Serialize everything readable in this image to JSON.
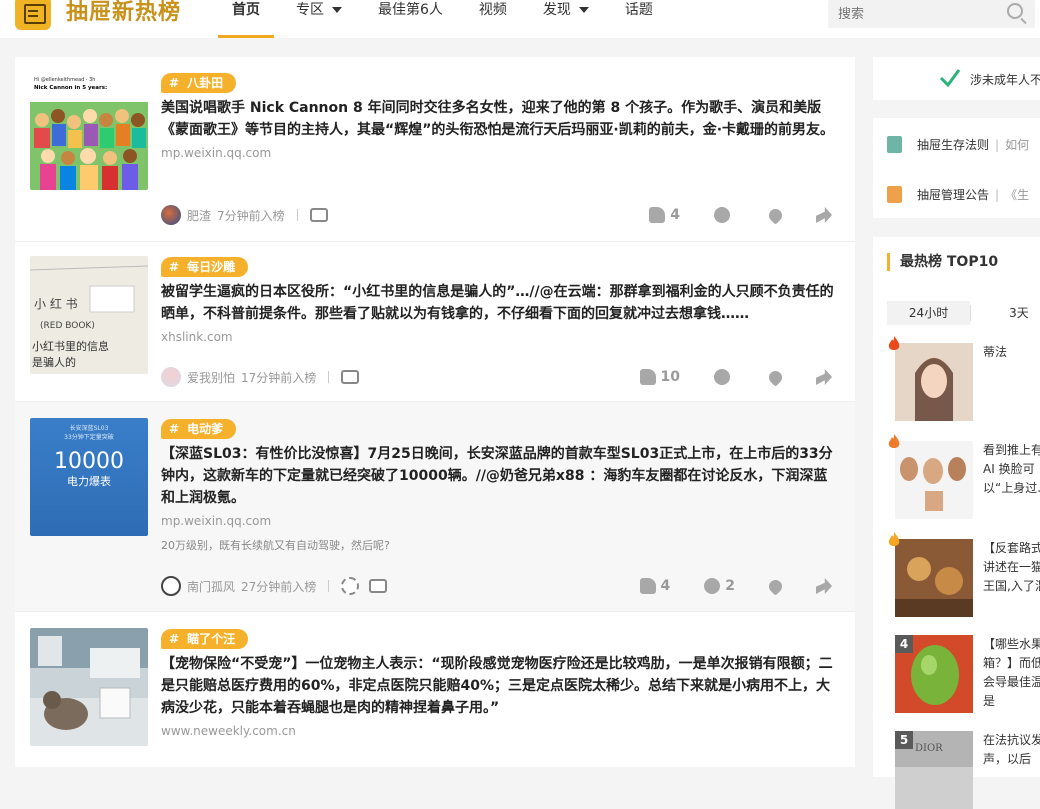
{
  "header": {
    "logo_text": "抽屉新热榜",
    "nav": [
      "首页",
      "专区",
      "最佳第6人",
      "视频",
      "发现",
      "话题"
    ],
    "search_placeholder": "搜索"
  },
  "posts": [
    {
      "tag": "八卦田",
      "thumb_text_1": "Hi @ellenkeithmead · 3h",
      "thumb_text_2": "Nick Cannon in 5 years:",
      "title": "美国说唱歌手 Nick Cannon 8 年间同时交往多名女性，迎来了他的第 8 个孩子。作为歌手、演员和美版《蒙面歌王》等节目的主持人，其最“辉煌”的头衔恐怕是流行天后玛丽亚·凯莉的前夫，金·卡戴珊的前男友。",
      "domain": "mp.weixin.qq.com",
      "author": "肥渣",
      "time": "7分钟前入榜",
      "likes": "4",
      "comments": ""
    },
    {
      "tag": "每日沙雕",
      "thumb_text_1": "(RED BOOK)",
      "thumb_text_2": "小红书里的信息是骗人的",
      "title": "被留学生逼疯的日本区役所：“小红书里的信息是骗人的”…//@在云端：那群拿到福利金的人只顾不负责任的晒单，不科普前提条件。那些看了贴就以为有钱拿的，不仔细看下面的回复就冲过去想拿钱……",
      "domain": "xhslink.com",
      "author": "爱我别怕",
      "time": "17分钟前入榜",
      "likes": "10",
      "comments": ""
    },
    {
      "tag": "电动爹",
      "thumb_text_1": "长安深蓝SL03",
      "thumb_text_2": "33分钟下定量突破",
      "thumb_text_3": "10000",
      "thumb_text_4": "电力爆表",
      "title": "【深蓝SL03：有性价比没惊喜】7月25日晚间，长安深蓝品牌的首款车型SL03正式上市，在上市后的33分钟内，这款新车的下定量就已经突破了10000辆。//@奶爸兄弟x88 ：海豹车友圈都在讨论反水，下润深蓝和上润极氪。",
      "domain": "mp.weixin.qq.com",
      "excerpt": "20万级别，既有长续航又有自动驾驶，然后呢?",
      "author": "南门孤风",
      "time": "27分钟前入榜",
      "likes": "4",
      "comments": "2"
    },
    {
      "tag": "瞄了个汪",
      "title": "【宠物保险“不受宠”】一位宠物主人表示：“现阶段感觉宠物医疗险还是比较鸡肋，一是单次报销有限额；二是只能赔总医疗费用的60%，非定点医院只能赔40%；三是定点医院太稀少。总结下来就是小病用不上，大病没少花，只能本着吞蝇腿也是肉的精神捏着鼻子用。”",
      "domain": "www.neweekly.com.cn"
    }
  ],
  "right": {
    "notice": "涉未成年人不",
    "links": [
      {
        "label": "抽屉生存法则",
        "more": "如何"
      },
      {
        "label": "抽屉管理公告",
        "more": "《生"
      }
    ],
    "hot_title": "最热榜 TOP10",
    "tabs": [
      "24小时",
      "3天"
    ],
    "hot_items": [
      {
        "rank": "",
        "text": "蒂法"
      },
      {
        "rank": "",
        "text": "看到推上有的 AI 换脸可以“上身过..."
      },
      {
        "rank": "",
        "text": "【反套路式事讲述在一猫猫王国,入了混乱"
      },
      {
        "rank": "4",
        "text": "【哪些水果冰箱？】而低温会导最佳温度是"
      },
      {
        "rank": "5",
        "thumb_text": "DIOR",
        "text": "在法抗议发声，以后"
      }
    ]
  },
  "colors": {
    "accent": "#f5b12c",
    "logo": "#c8911a",
    "link_gray": "#999999"
  }
}
